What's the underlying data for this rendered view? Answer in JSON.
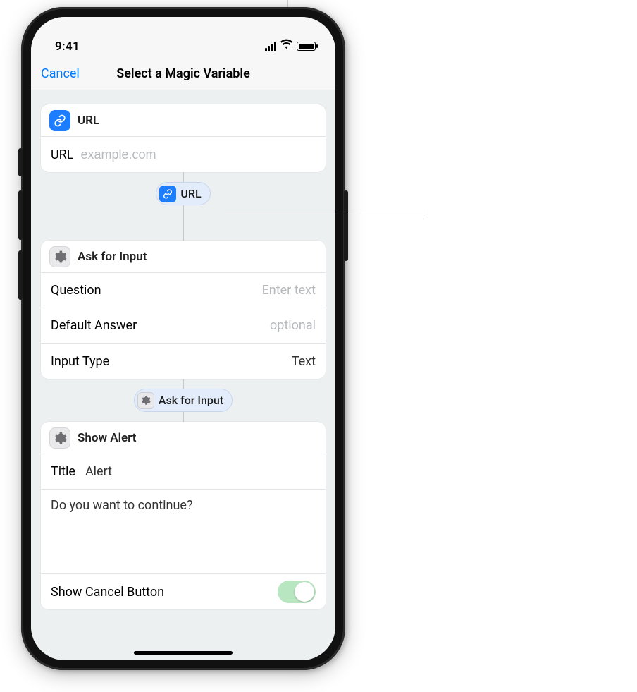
{
  "status": {
    "time": "9:41"
  },
  "nav": {
    "cancel": "Cancel",
    "title": "Select a Magic Variable"
  },
  "actions": {
    "url": {
      "title": "URL",
      "field_label": "URL",
      "placeholder": "example.com",
      "mv_label": "URL"
    },
    "ask": {
      "title": "Ask for Input",
      "rows": {
        "question_label": "Question",
        "question_placeholder": "Enter text",
        "default_label": "Default Answer",
        "default_placeholder": "optional",
        "type_label": "Input Type",
        "type_value": "Text"
      },
      "mv_label": "Ask for Input"
    },
    "alert": {
      "title": "Show Alert",
      "title_label": "Title",
      "title_value": "Alert",
      "message": "Do you want to continue?",
      "cancel_label": "Show Cancel Button",
      "cancel_on": true
    }
  }
}
